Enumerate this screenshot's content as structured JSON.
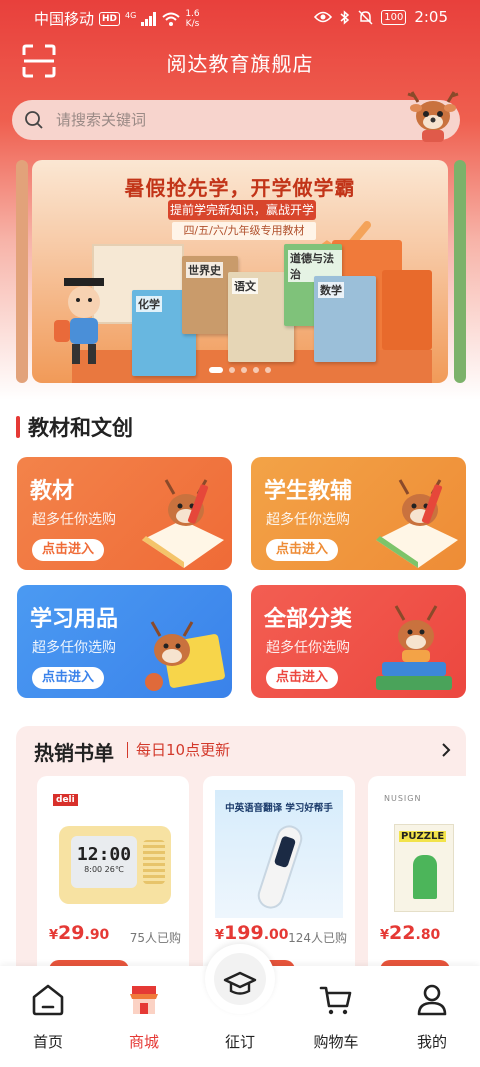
{
  "status_bar": {
    "carrier": "中国移动",
    "hd": "HD",
    "network": "4G",
    "speed_value": "1.6",
    "speed_unit": "K/s",
    "battery": "100",
    "time": "2:05"
  },
  "header": {
    "title": "阅达教育旗舰店"
  },
  "search": {
    "placeholder": "请搜索关键词"
  },
  "banner": {
    "headline": "暑假抢先学，开学做学霸",
    "subline": "提前学完新知识，赢战开学第一关",
    "tag": "四/五/六/九年级专用教材",
    "book_titles": [
      "化学",
      "世界史",
      "语文",
      "道德与法治",
      "数学"
    ],
    "slide_count": 5,
    "active_slide": 0
  },
  "section": {
    "title": "教材和文创"
  },
  "categories": [
    {
      "title": "教材",
      "subtitle": "超多任你选购",
      "button": "点击进入",
      "color": "#f2793f"
    },
    {
      "title": "学生教辅",
      "subtitle": "超多任你选购",
      "button": "点击进入",
      "color": "#f0983a"
    },
    {
      "title": "学习用品",
      "subtitle": "超多任你选购",
      "button": "点击进入",
      "color": "#3d8ef0"
    },
    {
      "title": "全部分类",
      "subtitle": "超多任你选购",
      "button": "点击进入",
      "color": "#f0534a"
    }
  ],
  "hot": {
    "title": "热销书单",
    "subtitle": "每日10点更新",
    "products": [
      {
        "brand": "deli",
        "clock_time": "12:00",
        "clock_sub": "8:00",
        "clock_temp": "26℃",
        "currency": "¥",
        "price_int": "29",
        "price_dec": ".90",
        "sold": "75人已购"
      },
      {
        "headline": "中英语音翻译 学习好帮手",
        "currency": "¥",
        "price_int": "199",
        "price_dec": ".00",
        "sold": "124人已购"
      },
      {
        "brand": "NUSIGN",
        "label": "PUZZLE",
        "currency": "¥",
        "price_int": "22",
        "price_dec": ".80"
      }
    ]
  },
  "tabbar": {
    "items": [
      {
        "label": "首页",
        "icon": "home-icon"
      },
      {
        "label": "商城",
        "icon": "shop-icon"
      },
      {
        "label": "征订",
        "icon": "graduation-cap-icon"
      },
      {
        "label": "购物车",
        "icon": "cart-icon"
      },
      {
        "label": "我的",
        "icon": "user-icon"
      }
    ],
    "active_index": 1,
    "accent": "#e53935"
  }
}
